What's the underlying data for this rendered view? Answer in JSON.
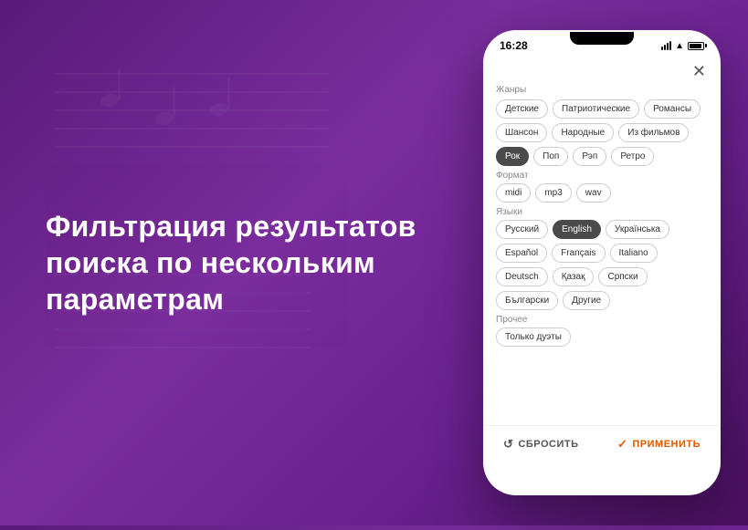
{
  "background": {
    "gradient_start": "#5a1a7a",
    "gradient_end": "#4a1060"
  },
  "left_section": {
    "title": "Фильтрация результатов поиска по нескольким параметрам"
  },
  "phone": {
    "status_bar": {
      "time": "16:28"
    },
    "close_button_label": "✕",
    "sections": [
      {
        "id": "genres",
        "label": "Жанры",
        "tags": [
          {
            "label": "Детские",
            "active": false
          },
          {
            "label": "Патриотические",
            "active": false
          },
          {
            "label": "Романсы",
            "active": false
          },
          {
            "label": "Шансон",
            "active": false
          },
          {
            "label": "Народные",
            "active": false
          },
          {
            "label": "Из фильмов",
            "active": false
          },
          {
            "label": "Рок",
            "active": true
          },
          {
            "label": "Поп",
            "active": false
          },
          {
            "label": "Рэп",
            "active": false
          },
          {
            "label": "Ретро",
            "active": false
          }
        ]
      },
      {
        "id": "format",
        "label": "Формат",
        "tags": [
          {
            "label": "midi",
            "active": false
          },
          {
            "label": "mp3",
            "active": false
          },
          {
            "label": "wav",
            "active": false
          }
        ]
      },
      {
        "id": "languages",
        "label": "Языки",
        "tags": [
          {
            "label": "Русский",
            "active": false
          },
          {
            "label": "English",
            "active": true
          },
          {
            "label": "Українська",
            "active": false
          },
          {
            "label": "Español",
            "active": false
          },
          {
            "label": "Français",
            "active": false
          },
          {
            "label": "Italiano",
            "active": false
          },
          {
            "label": "Deutsch",
            "active": false
          },
          {
            "label": "Қазақ",
            "active": false
          },
          {
            "label": "Српски",
            "active": false
          },
          {
            "label": "Български",
            "active": false
          },
          {
            "label": "Другие",
            "active": false
          }
        ]
      },
      {
        "id": "other",
        "label": "Прочее",
        "tags": [
          {
            "label": "Только дуэты",
            "active": false
          }
        ]
      }
    ],
    "bottom_bar": {
      "reset_label": "СБРОСИТЬ",
      "apply_label": "ПРИМЕНИТЬ"
    }
  }
}
